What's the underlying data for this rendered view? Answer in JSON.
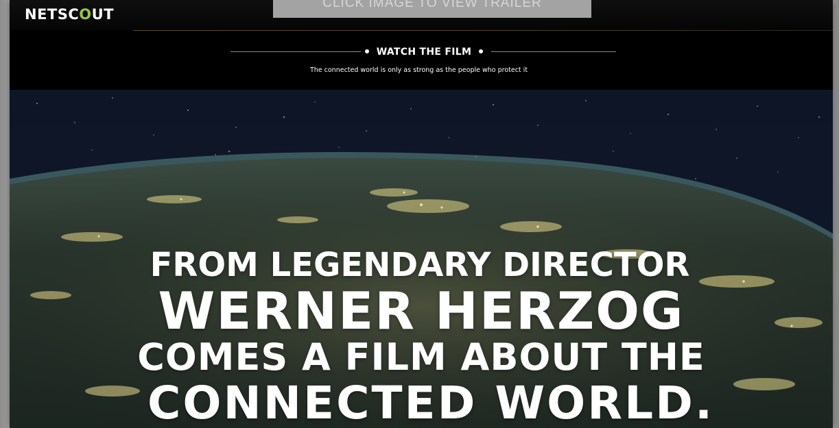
{
  "header": {
    "logo_prefix": "NETSC",
    "logo_highlight": "O",
    "logo_suffix": "UT",
    "logo_accent_color": "#9bc63b",
    "trailer_tab_label": "CLICK IMAGE TO VIEW TRAILER"
  },
  "watch_section": {
    "title": "WATCH THE FILM",
    "subtitle": "The connected world is only as strong as the people who protect it"
  },
  "hero": {
    "line1": "FROM LEGENDARY DIRECTOR",
    "line2": "WERNER HERZOG",
    "line3": "COMES A FILM ABOUT THE",
    "line4": "CONNECTED WORLD."
  },
  "colors": {
    "background": "#000000",
    "frame": "#d9d9d9",
    "tab": "#a3a3a3"
  }
}
